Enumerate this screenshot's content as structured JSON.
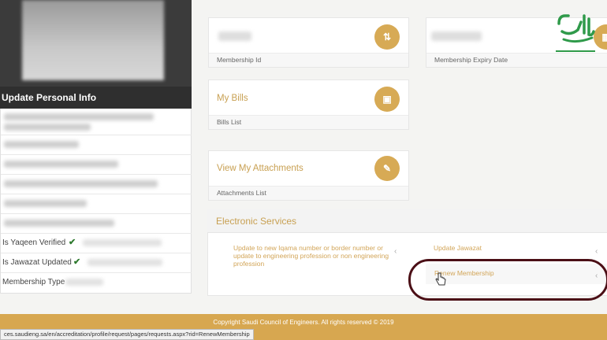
{
  "left_panel": {
    "update_label": "Update Personal Info",
    "yaqeen_label": "Is Yaqeen Verified",
    "jawazat_label": "Is Jawazat Updated",
    "membership_type_label": "Membership Type",
    "check_glyph": "✔"
  },
  "cards": {
    "membership_id_label": "Membership Id",
    "membership_expiry_label": "Membership Expiry Date",
    "my_bills_title": "My Bills",
    "bills_list_label": "Bills List",
    "attachments_title": "View My Attachments",
    "attachments_list_label": "Attachments List"
  },
  "services": {
    "header": "Electronic Services",
    "update_iqama": "Update to new Iqama number or border number or update to engineering profession or non engineering profession",
    "update_jawazat": "Update Jawazat",
    "renew_membership": "Renew Membership",
    "chevron_glyph": "‹"
  },
  "footer": {
    "copyright": "Copyright Saudi Council of Engineers. All rights reserved © 2019",
    "status_url": "ces.saudieng.sa/en/accreditation/profile/request/pages/requests.aspx?rid=RenewMembership"
  },
  "colors": {
    "accent": "#d7aa55",
    "dark_header": "#2f2f2f",
    "highlight_ring": "#4b0f16",
    "logo_green": "#2f9a4a"
  },
  "icons": {
    "membership_id": "sort-arrows-icon",
    "expiry": "calendar-icon",
    "bills": "save-icon",
    "attachments": "paperclip-icon",
    "cursor": "hand-pointer-icon",
    "logo": "saudi-logo-icon"
  }
}
